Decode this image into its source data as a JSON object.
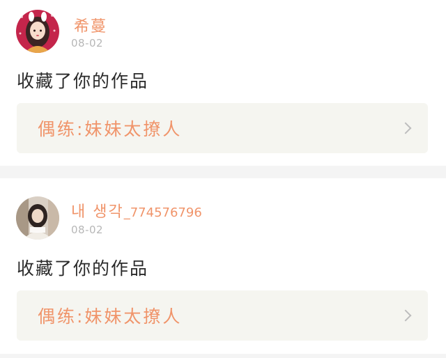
{
  "colors": {
    "accent": "#f0946a",
    "page_background": "#f4f4f4",
    "link_background": "#f5f5f0",
    "date_text": "#b7b7b7",
    "body_text": "#2a2a2a"
  },
  "notifications": [
    {
      "username": "希蔓",
      "username_suffix": "",
      "date": "08-02",
      "action": "收藏了你的作品",
      "work_title": "偶练:妹妹太撩人",
      "avatar_icon": "girl-portrait-avatar",
      "chevron_icon": "chevron-right-icon"
    },
    {
      "username": "내 생각",
      "username_suffix": "_774576796",
      "date": "08-02",
      "action": "收藏了你的作品",
      "work_title": "偶练:妹妹太撩人",
      "avatar_icon": "girl-photo-avatar",
      "chevron_icon": "chevron-right-icon"
    }
  ]
}
